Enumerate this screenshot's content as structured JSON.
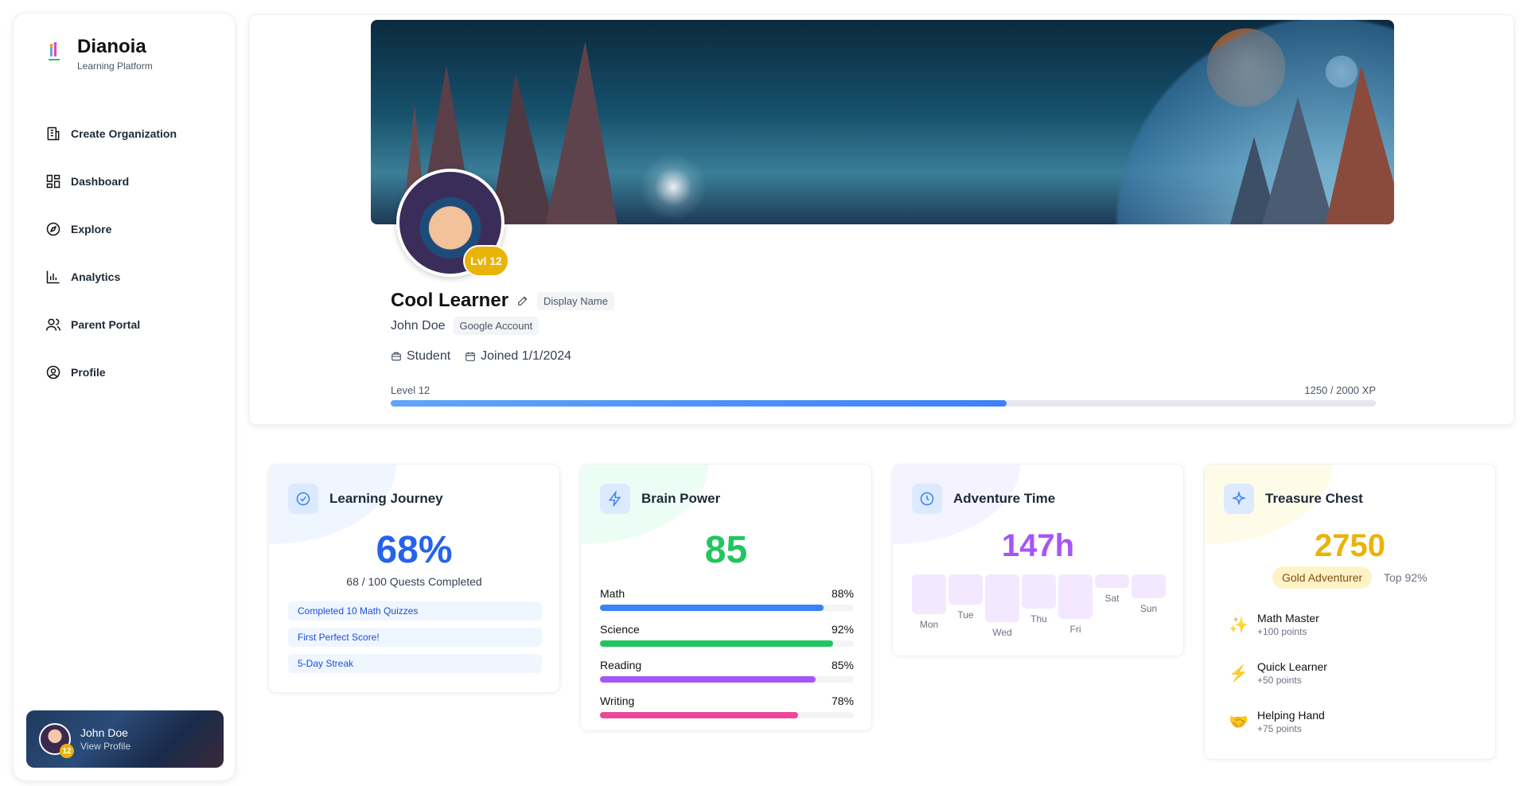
{
  "brand": {
    "name": "Dianoia",
    "subtitle": "Learning Platform"
  },
  "nav": [
    {
      "label": "Create Organization",
      "icon": "building-icon"
    },
    {
      "label": "Dashboard",
      "icon": "dashboard-icon"
    },
    {
      "label": "Explore",
      "icon": "compass-icon"
    },
    {
      "label": "Analytics",
      "icon": "bar-chart-icon"
    },
    {
      "label": "Parent Portal",
      "icon": "users-icon"
    },
    {
      "label": "Profile",
      "icon": "user-circle-icon"
    }
  ],
  "user_card": {
    "name": "John Doe",
    "action": "View Profile",
    "level": "12"
  },
  "profile": {
    "level_badge": "Lvl 12",
    "display_name": "Cool Learner",
    "display_name_tag": "Display Name",
    "real_name": "John Doe",
    "real_name_tag": "Google Account",
    "role": "Student",
    "joined": "Joined 1/1/2024",
    "level_label": "Level 12",
    "xp_text": "1250 / 2000 XP",
    "xp_progress": 0.625
  },
  "learning_journey": {
    "title": "Learning Journey",
    "percent": "68%",
    "subtitle": "68 / 100 Quests Completed",
    "achievements": [
      "Completed 10 Math Quizzes",
      "First Perfect Score!",
      "5-Day Streak"
    ]
  },
  "brain_power": {
    "title": "Brain Power",
    "score": "85",
    "skills": [
      {
        "name": "Math",
        "value": "88%",
        "pct": 88,
        "color": "#3b82f6"
      },
      {
        "name": "Science",
        "value": "92%",
        "pct": 92,
        "color": "#22c55e"
      },
      {
        "name": "Reading",
        "value": "85%",
        "pct": 85,
        "color": "#a855f7"
      },
      {
        "name": "Writing",
        "value": "78%",
        "pct": 78,
        "color": "#ec4899"
      }
    ]
  },
  "adventure_time": {
    "title": "Adventure Time",
    "hours": "147h",
    "days": [
      {
        "label": "Mon",
        "level": 0.8
      },
      {
        "label": "Tue",
        "level": 0.57
      },
      {
        "label": "Wed",
        "level": 1.0
      },
      {
        "label": "Thu",
        "level": 0.67
      },
      {
        "label": "Fri",
        "level": 0.92
      },
      {
        "label": "Sat",
        "level": 0.16
      },
      {
        "label": "Sun",
        "level": 0.41
      }
    ]
  },
  "treasure_chest": {
    "title": "Treasure Chest",
    "points": "2750",
    "rank": "Gold Adventurer",
    "top": "Top 92%",
    "rewards": [
      {
        "icon": "✨",
        "name": "Math Master",
        "points": "+100 points"
      },
      {
        "icon": "⚡",
        "name": "Quick Learner",
        "points": "+50 points"
      },
      {
        "icon": "🤝",
        "name": "Helping Hand",
        "points": "+75 points"
      }
    ]
  }
}
